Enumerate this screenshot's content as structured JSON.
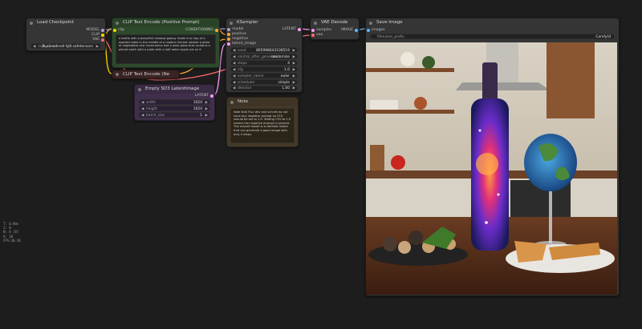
{
  "nodes": {
    "load_checkpoint": {
      "title": "Load Checkpoint",
      "outputs": [
        "MODEL",
        "CLIP",
        "VAE"
      ],
      "widget_label": "ckpt_name",
      "widget_value": "flux1-schnell-fp8.safetensors"
    },
    "clip_pos": {
      "title": "CLIP Text Encode (Positive Prompt)",
      "input": "clip",
      "output": "CONDITIONING",
      "text": "a bottle with a beautiful rainbow galaxy inside it on top of a wooden table in the middle of a modern kitchen beside a plate of vegetables and mushrooms and a wine glass that contains a planet earth with a plate with a half eaten apple pie on it"
    },
    "clip_neg": {
      "title": "CLIP Text Encode (Ne"
    },
    "ksampler": {
      "title": "KSampler",
      "inputs": [
        "model",
        "positive",
        "negative",
        "latent_image"
      ],
      "output": "LATENT",
      "widgets": [
        {
          "label": "seed",
          "value": "865998643108519"
        },
        {
          "label": "control_after_generate",
          "value": "randomize"
        },
        {
          "label": "steps",
          "value": "4"
        },
        {
          "label": "cfg",
          "value": "1.0"
        },
        {
          "label": "sampler_name",
          "value": "euler"
        },
        {
          "label": "scheduler",
          "value": "simple"
        },
        {
          "label": "denoise",
          "value": "1.00"
        }
      ]
    },
    "vae_decode": {
      "title": "VAE Decode",
      "inputs": [
        "samples",
        "vae"
      ],
      "output": "IMAGE"
    },
    "save_image": {
      "title": "Save Image",
      "input": "images",
      "widget_label": "filename_prefix",
      "widget_value": "ComfyUI"
    },
    "empty_latent": {
      "title": "Empty SD3 LatentImage",
      "output": "LATENT",
      "widgets": [
        {
          "label": "width",
          "value": "1024"
        },
        {
          "label": "height",
          "value": "1024"
        },
        {
          "label": "batch_size",
          "value": "1"
        }
      ]
    },
    "note": {
      "title": "Note",
      "text": "Note that Flux dev and schnell do not have any negative prompt so CFG should be set to 1.0. Setting CFG to 1.0 means the negative prompt is ignored.\nThe schnell model is a distilled model that can generate a good image with only 4 steps."
    }
  },
  "stats": [
    "T: 0.00s",
    "I: 0",
    "N: 0 [0]",
    "V: 10",
    "FPS:30.30"
  ],
  "colors": {
    "model": "#b39ddb",
    "clip": "#ffd500",
    "vae": "#ff6e6e",
    "conditioning": "#ffa931",
    "latent": "#ff9cf9",
    "image": "#64b5f6",
    "clip_node_green": "#2e4a2c",
    "latent_node_purple": "#3f2f4a",
    "note_node_brown": "#443a2a"
  }
}
